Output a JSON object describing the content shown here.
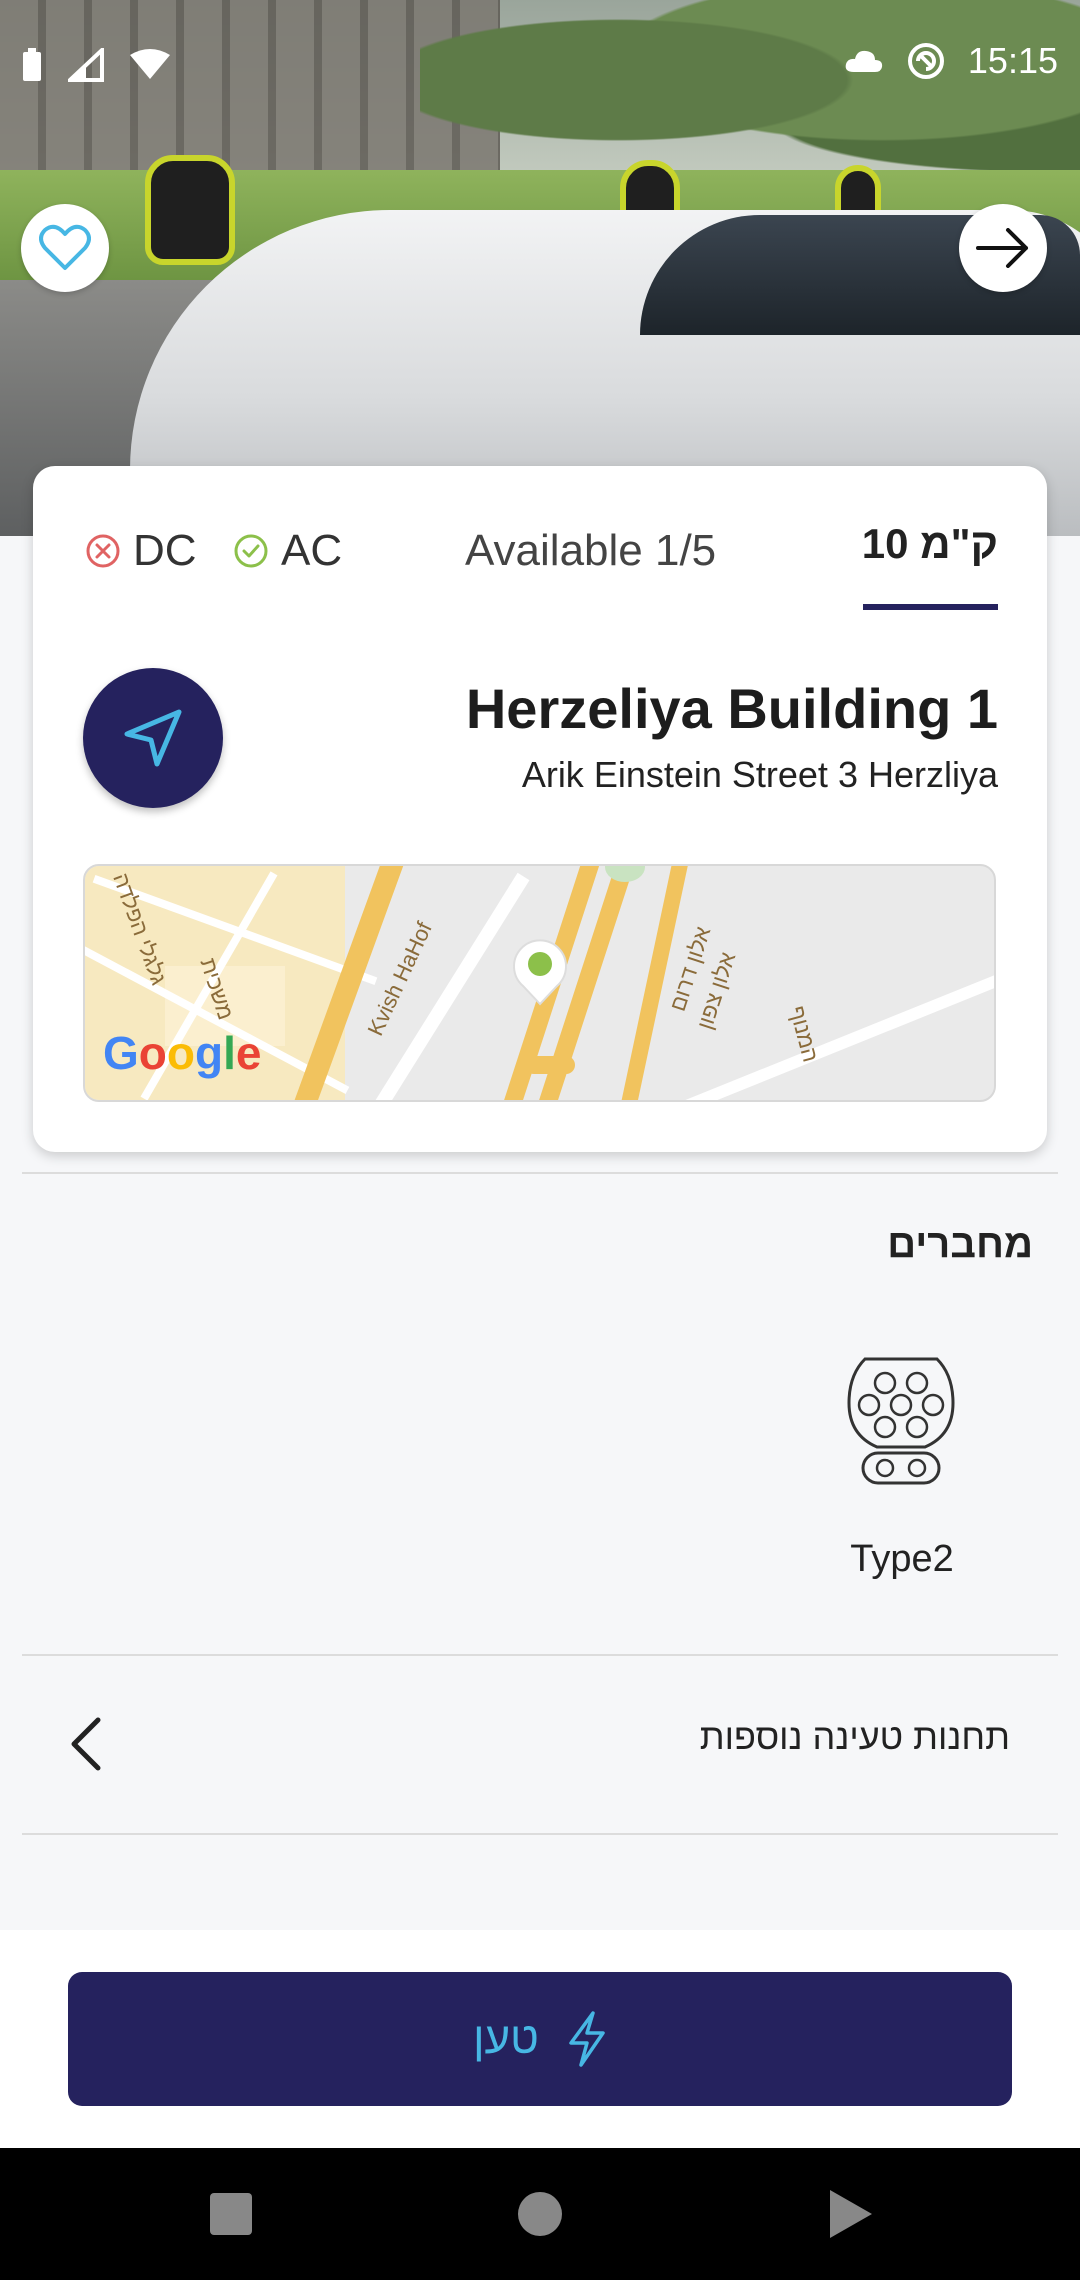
{
  "status_bar": {
    "time": "15:15",
    "left_icons": [
      "battery-icon",
      "signal-icon",
      "wifi-icon"
    ],
    "right_icons": [
      "cloud-icon",
      "vpn-icon"
    ]
  },
  "hero": {
    "image": "ev-charging-station-photo",
    "favorite_icon": "heart-outline-icon",
    "forward_icon": "arrow-right-icon"
  },
  "availability": {
    "dc_label": "DC",
    "dc_status": "unavailable",
    "ac_label": "AC",
    "ac_status": "available",
    "available_text": "Available 1/5",
    "distance": "10 ק\"מ"
  },
  "station": {
    "name": "Herzeliya Building 1",
    "address": "Arik Einstein Street 3 Herzliya"
  },
  "map": {
    "labels": [
      "Kvish HaHof",
      "אלון דרום",
      "אלון צפון",
      "גלגלי הפלדה",
      "משכית",
      "המנוף"
    ],
    "provider": "Google"
  },
  "connectors": {
    "title": "מחברים",
    "items": [
      {
        "label": "Type2",
        "icon": "type2-connector-icon"
      }
    ]
  },
  "more_stations": {
    "label": "תחנות טעינה נוספות"
  },
  "charge_button": {
    "label": "טען",
    "icon": "lightning-icon"
  },
  "colors": {
    "brand_navy": "#25225e",
    "accent_cyan": "#47b7e4",
    "error_red": "#e06363",
    "success_green": "#8cc04a"
  }
}
